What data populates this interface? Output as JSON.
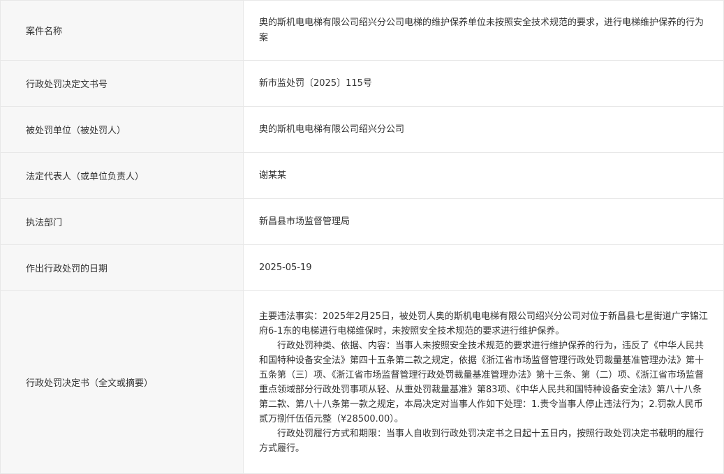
{
  "rows": [
    {
      "label": "案件名称",
      "value": "奥的斯机电电梯有限公司绍兴分公司电梯的维护保养单位未按照安全技术规范的要求，进行电梯维护保养的行为案"
    },
    {
      "label": "行政处罚决定文书号",
      "value": "新市监处罚〔2025〕115号"
    },
    {
      "label": "被处罚单位（被处罚人）",
      "value": "奥的斯机电电梯有限公司绍兴分公司"
    },
    {
      "label": "法定代表人（或单位负责人）",
      "value": "谢某某"
    },
    {
      "label": "执法部门",
      "value": "新昌县市场监督管理局"
    },
    {
      "label": "作出行政处罚的日期",
      "value": "2025-05-19"
    }
  ],
  "decision": {
    "label": "行政处罚决定书（全文或摘要）",
    "paragraphs": [
      "主要违法事实：2025年2月25日，被处罚人奥的斯机电电梯有限公司绍兴分公司对位于新昌县七星街道广宇锦江府6-1东的电梯进行电梯维保时，未按照安全技术规范的要求进行维护保养。",
      "行政处罚种类、依据、内容：当事人未按照安全技术规范的要求进行维护保养的行为，违反了《中华人民共和国特种设备安全法》第四十五条第二款之规定，依据《浙江省市场监督管理行政处罚裁量基准管理办法》第十五条第（三）项、《浙江省市场监督管理行政处罚裁量基准管理办法》第十三条、第（二）项、《浙江省市场监督重点领域部分行政处罚事项从轻、从重处罚裁量基准》第83项、《中华人民共和国特种设备安全法》第八十八条第二款、第八十八条第一款之规定，本局决定对当事人作如下处理：1.责令当事人停止违法行为；2.罚款人民币贰万捌仟伍佰元整（¥28500.00）。",
      "行政处罚履行方式和期限：当事人自收到行政处罚决定书之日起十五日内，按照行政处罚决定书载明的履行方式履行。"
    ]
  }
}
